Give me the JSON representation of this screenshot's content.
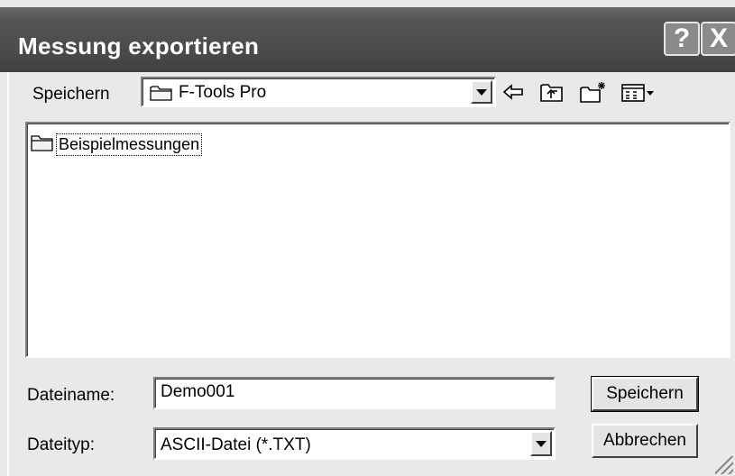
{
  "window": {
    "title": "Messung exportieren",
    "help_button": "?",
    "close_button": "X"
  },
  "location": {
    "label": "Speichern",
    "current_folder": "F-Tools Pro"
  },
  "toolbar": {
    "icons": [
      "back-arrow-icon",
      "up-folder-icon",
      "new-folder-icon",
      "view-menu-icon"
    ]
  },
  "file_list": {
    "items": [
      {
        "label": "Beispielmessungen",
        "icon": "folder-icon"
      }
    ]
  },
  "filename": {
    "label": "Dateiname:",
    "value": "Demo001"
  },
  "filetype": {
    "label": "Dateityp:",
    "value": "ASCII-Datei (*.TXT)"
  },
  "buttons": {
    "save": "Speichern",
    "cancel": "Abbrechen"
  }
}
